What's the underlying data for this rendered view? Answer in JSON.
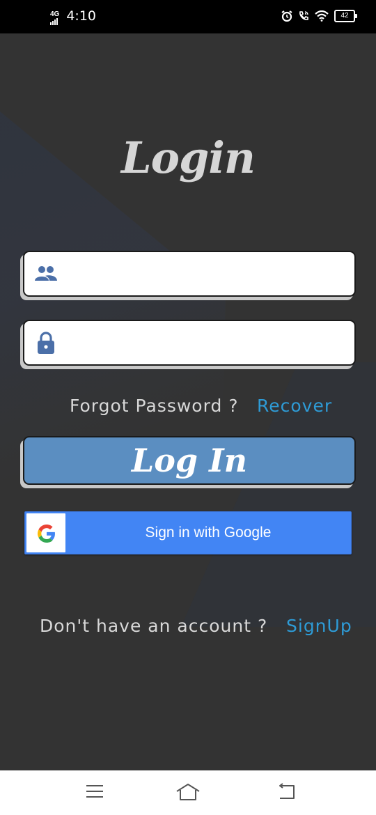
{
  "status_bar": {
    "network": "4G",
    "time": "4:10",
    "battery": "42",
    "icons": [
      "alarm-icon",
      "call-icon",
      "wifi-icon",
      "battery-icon"
    ]
  },
  "login": {
    "title": "Login",
    "username_field": {
      "value": "",
      "placeholder": "",
      "icon": "users-icon"
    },
    "password_field": {
      "value": "",
      "placeholder": "",
      "icon": "lock-icon"
    },
    "forgot_text": "Forgot Password ?",
    "recover_link": "Recover",
    "login_button": "Log In",
    "google_button": "Sign in with Google",
    "no_account_text": "Don't have an account ?",
    "signup_link": "SignUp"
  },
  "colors": {
    "background": "#333333",
    "accent_link": "#2e9bd6",
    "login_button": "#5b8ec1",
    "google_blue": "#4285f4",
    "icon_blue": "#4b6fa8"
  },
  "nav_bar": {
    "icons": [
      "menu-icon",
      "home-icon",
      "back-icon"
    ]
  }
}
